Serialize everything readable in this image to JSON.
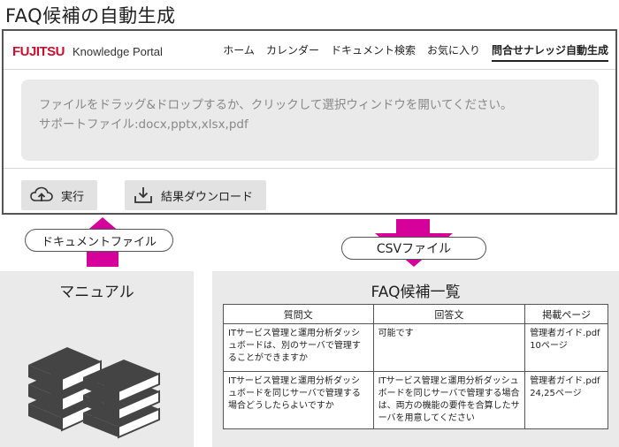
{
  "page_title": "FAQ候補の自動生成",
  "portal": {
    "brand_logo": "FUJITSU",
    "brand_name": "Knowledge Portal",
    "nav": [
      {
        "label": "ホーム",
        "active": false
      },
      {
        "label": "カレンダー",
        "active": false
      },
      {
        "label": "ドキュメント検索",
        "active": false
      },
      {
        "label": "お気に入り",
        "active": false
      },
      {
        "label": "問合せナレッジ自動生成",
        "active": true
      }
    ],
    "dropzone": {
      "line1": "ファイルをドラッグ&ドロップするか、クリックして選択ウィンドウを開いてください。",
      "line2": "サポートファイル:docx,pptx,xlsx,pdf"
    },
    "run_button": {
      "label": "実行",
      "icon": "cloud-upload-icon"
    },
    "download_button": {
      "label": "結果ダウンロード",
      "icon": "download-icon"
    }
  },
  "flow": {
    "upload_label": "ドキュメントファイル",
    "output_label": "CSVファイル",
    "arrow_color": "#d6009b"
  },
  "manual_panel": {
    "title": "マニュアル",
    "icon": "books-icon"
  },
  "faq_panel": {
    "title": "FAQ候補一覧",
    "columns": [
      "質問文",
      "回答文",
      "掲載ページ"
    ],
    "rows": [
      {
        "question": "ITサービス管理と運用分析ダッシュボードは、別のサーバで管理することができますか",
        "answer": "可能です",
        "page": "管理者ガイド.pdf 10ページ"
      },
      {
        "question": "ITサービス管理と運用分析ダッシュボードを同じサーバで管理する場合どうしたらよいですか",
        "answer": "ITサービス管理と運用分析ダッシュボードを同じサーバで管理する場合は、両方の機能の要件を合算したサーバを用意してください",
        "page": "管理者ガイド.pdf 24,25ページ"
      }
    ]
  }
}
